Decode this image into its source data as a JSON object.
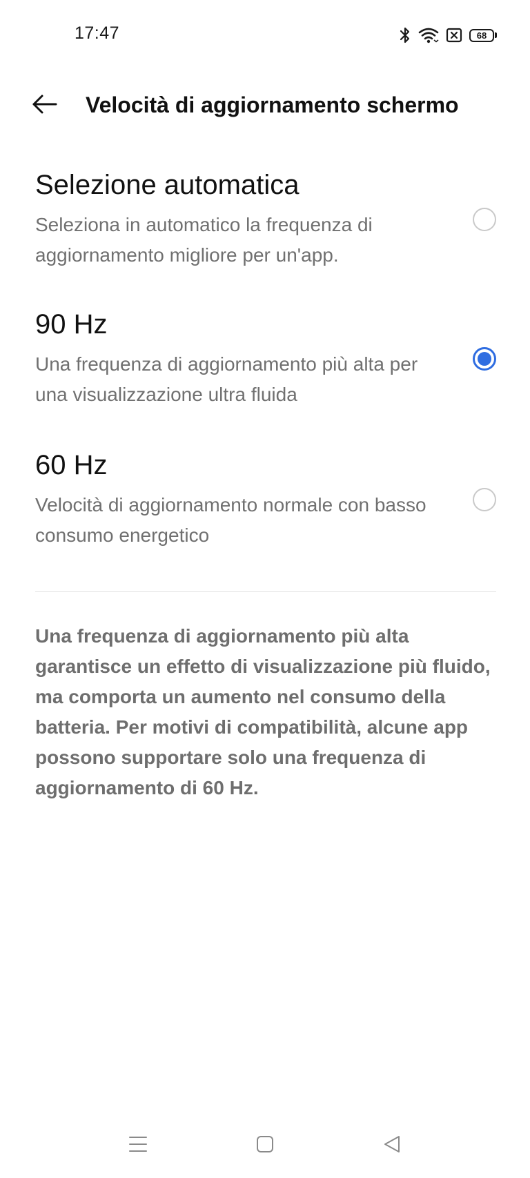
{
  "status_bar": {
    "time": "17:47",
    "battery_level": "68",
    "icons": [
      "bluetooth-icon",
      "wifi-icon",
      "sim-off-icon",
      "battery-icon"
    ]
  },
  "header": {
    "title": "Velocità di aggiornamento schermo",
    "back_icon": "arrow-left-icon"
  },
  "options": [
    {
      "title": "Selezione automatica",
      "description": "Seleziona in automatico la frequenza di aggiornamento migliore per un'app.",
      "selected": false
    },
    {
      "title": "90 Hz",
      "description": "Una frequenza di aggiornamento più alta per una visualizzazione ultra fluida",
      "selected": true
    },
    {
      "title": "60 Hz",
      "description": "Velocità di aggiornamento normale con basso consumo energetico",
      "selected": false
    }
  ],
  "info_text": "Una frequenza di aggiornamento più alta garantisce un effetto di visualizzazione più fluido, ma comporta un aumento nel consumo della batteria. Per motivi di compatibilità, alcune app possono supportare solo una frequenza di aggiornamento di 60 Hz.",
  "navigation": {
    "buttons": [
      "menu-icon",
      "home-icon",
      "back-triangle-icon"
    ]
  },
  "colors": {
    "accent": "#2f6de1",
    "secondary_text": "#707070",
    "info_text": "#6e6e6e",
    "divider": "#e3e3e3"
  }
}
